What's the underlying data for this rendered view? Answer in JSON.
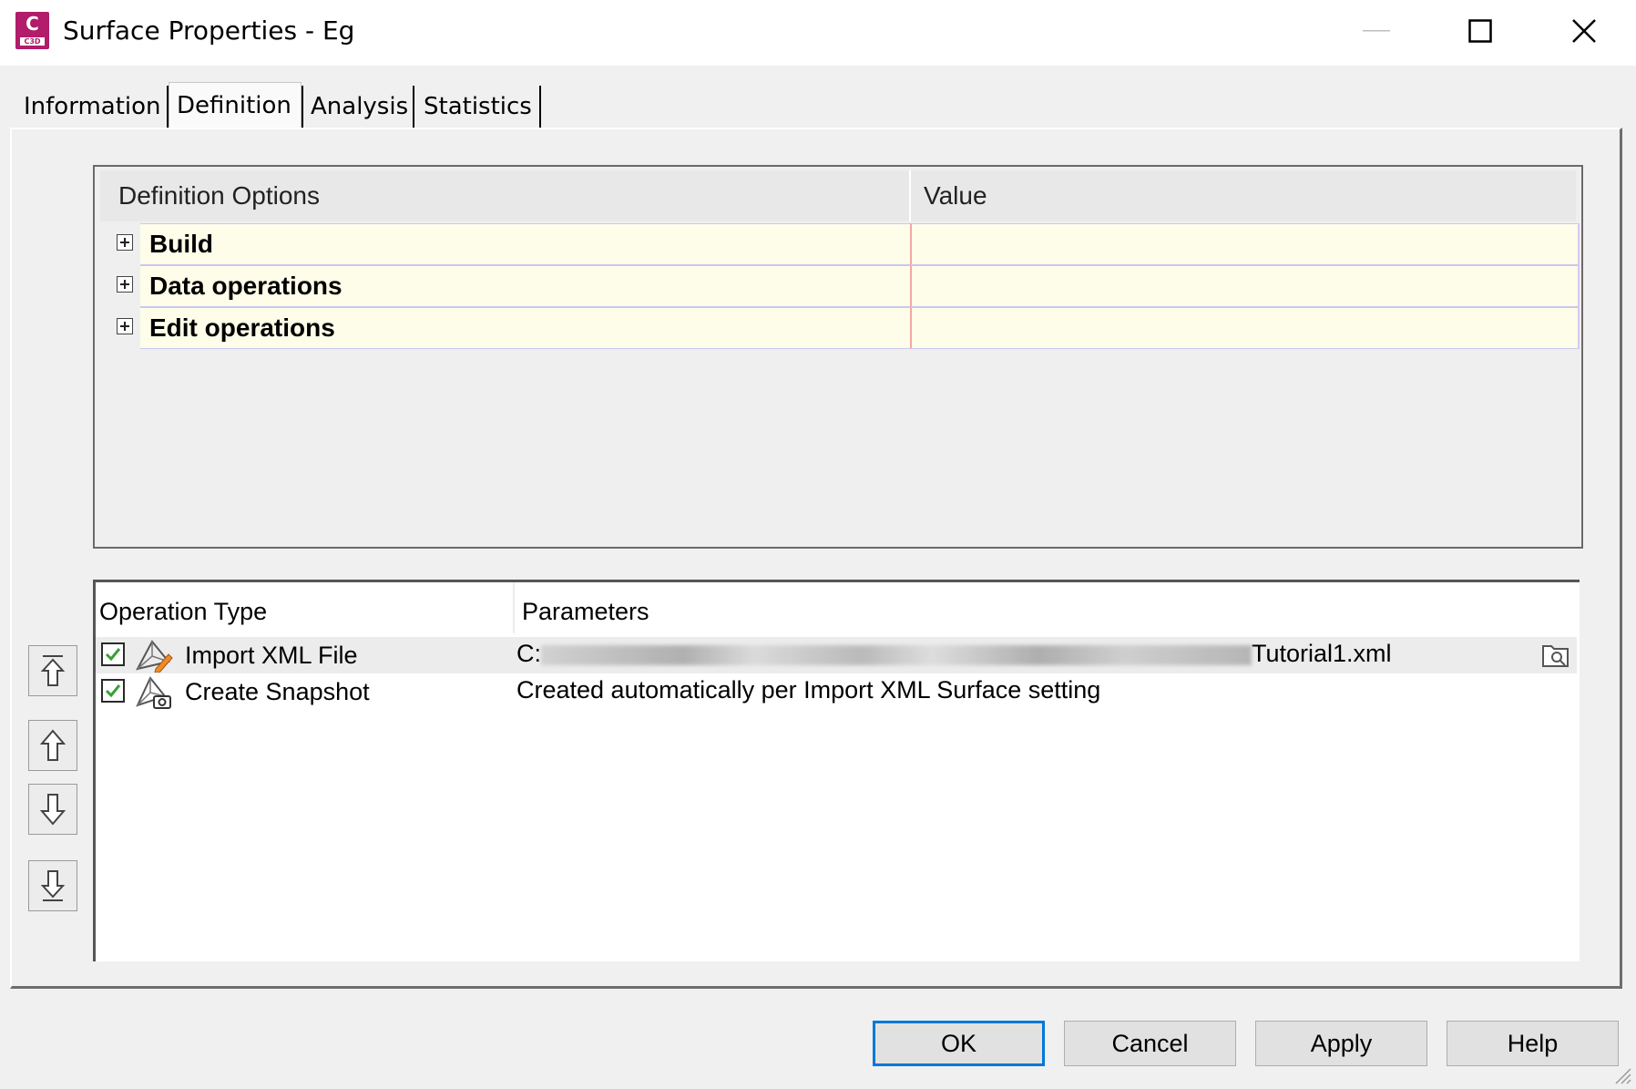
{
  "window": {
    "title": "Surface Properties - Eg",
    "app_icon_letter": "C",
    "app_icon_sub": "C3D"
  },
  "tabs": [
    {
      "label": "Information",
      "active": false
    },
    {
      "label": "Definition",
      "active": true
    },
    {
      "label": "Analysis",
      "active": false
    },
    {
      "label": "Statistics",
      "active": false
    }
  ],
  "definition_grid": {
    "headers": {
      "options": "Definition Options",
      "value": "Value"
    },
    "rows": [
      {
        "label": "Build",
        "value": ""
      },
      {
        "label": "Data operations",
        "value": ""
      },
      {
        "label": "Edit operations",
        "value": ""
      }
    ]
  },
  "operations": {
    "headers": {
      "type": "Operation Type",
      "parameters": "Parameters"
    },
    "rows": [
      {
        "checked": true,
        "icon": "import-xml-icon",
        "type": "Import XML File",
        "param_prefix": "C:",
        "param_suffix": "Tutorial1.xml",
        "selected": true
      },
      {
        "checked": true,
        "icon": "snapshot-icon",
        "type": "Create Snapshot",
        "param": "Created automatically per Import XML Surface setting",
        "selected": false
      }
    ]
  },
  "side_buttons": [
    "move-to-top",
    "move-up",
    "move-down",
    "move-to-bottom"
  ],
  "footer": {
    "ok": "OK",
    "cancel": "Cancel",
    "apply": "Apply",
    "help": "Help"
  },
  "colors": {
    "accent": "#0078d7",
    "app_icon": "#b11c6b",
    "row_highlight": "#fefde9",
    "check": "#3aa035"
  }
}
